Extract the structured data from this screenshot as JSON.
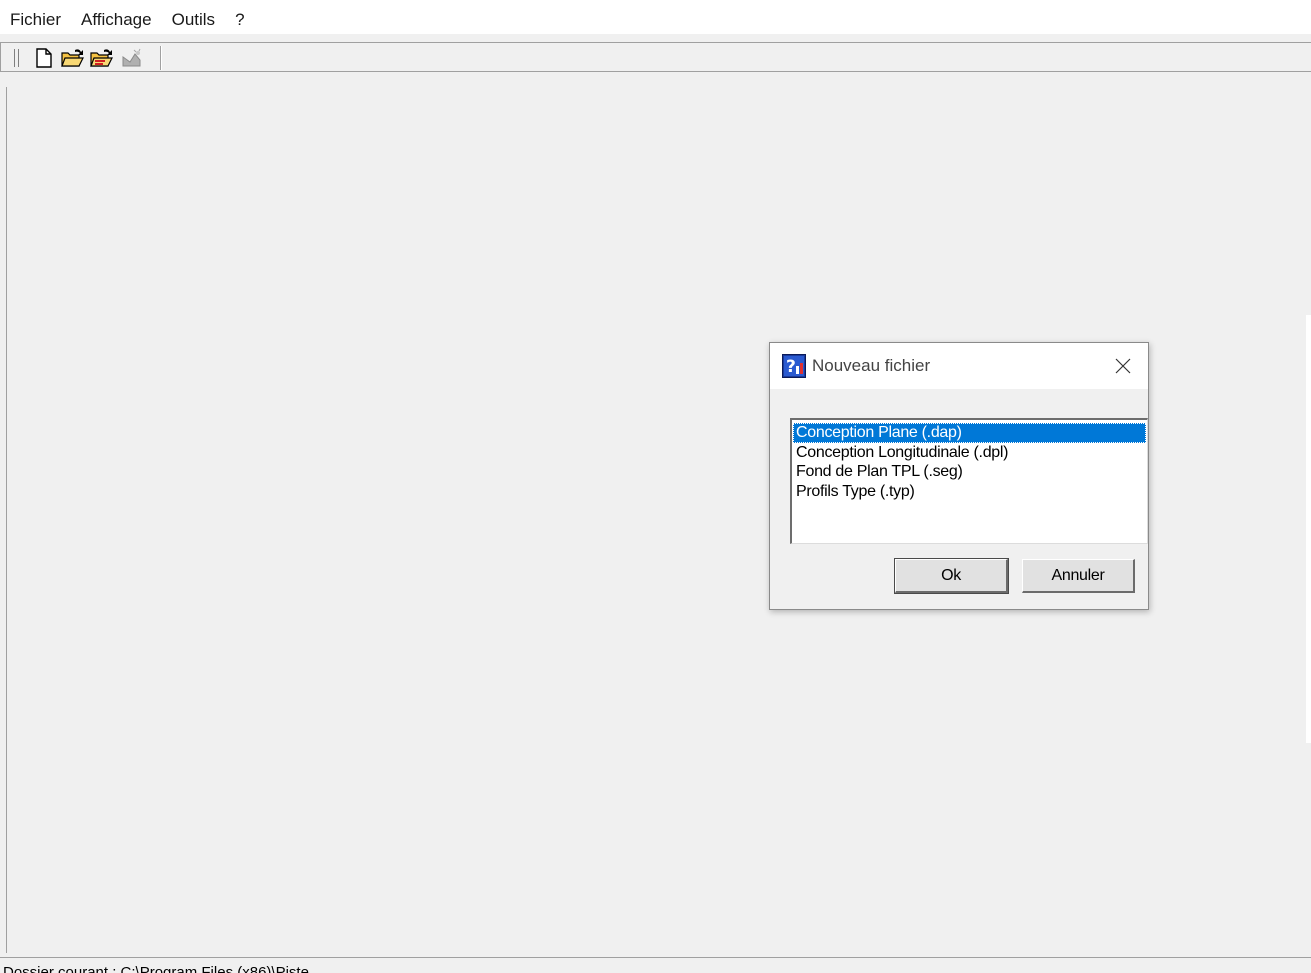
{
  "menubar": {
    "items": [
      "Fichier",
      "Affichage",
      "Outils",
      "?"
    ]
  },
  "toolbar": {
    "buttons": [
      {
        "name": "new-file",
        "icon": "new-document-icon"
      },
      {
        "name": "open-file",
        "icon": "open-folder-icon"
      },
      {
        "name": "open-folder-red",
        "icon": "open-folder-red-icon"
      },
      {
        "name": "disabled-tool",
        "icon": "tool-disabled-icon"
      }
    ]
  },
  "dialog": {
    "title": "Nouveau fichier",
    "list": {
      "items": [
        "Conception Plane (.dap)",
        "Conception Longitudinale (.dpl)",
        "Fond de Plan TPL (.seg)",
        "Profils Type (.typ)"
      ],
      "selected_index": 0
    },
    "ok_label": "Ok",
    "cancel_label": "Annuler"
  },
  "statusbar": {
    "text": "Dossier courant : C:\\Program Files (x86)\\Piste"
  },
  "colors": {
    "selection": "#0078d7",
    "background": "#f0f0f0"
  }
}
